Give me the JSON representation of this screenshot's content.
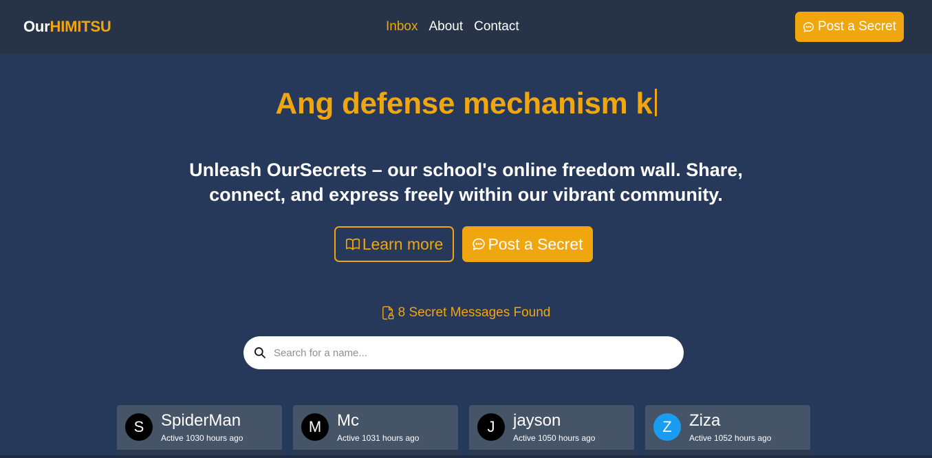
{
  "nav": {
    "logo_part1": "Our",
    "logo_part2": "HIMITSU",
    "links": [
      {
        "label": "Inbox",
        "active": true
      },
      {
        "label": "About",
        "active": false
      },
      {
        "label": "Contact",
        "active": false
      }
    ],
    "post_button": "Post a Secret"
  },
  "hero": {
    "title": "Ang defense mechanism k",
    "subtitle_line1": "Unleash OurSecrets – our school's online freedom wall. Share,",
    "subtitle_line2": "connect, and express freely within our vibrant community.",
    "learn_button": "Learn more",
    "post_button": "Post a Secret"
  },
  "messages": {
    "count_text": "8 Secret Messages Found"
  },
  "search": {
    "placeholder": "Search for a name..."
  },
  "cards": [
    {
      "initial": "S",
      "name": "SpiderMan",
      "status": "Active 1030 hours ago",
      "avatar_color": "#000000"
    },
    {
      "initial": "M",
      "name": "Mc",
      "status": "Active 1031 hours ago",
      "avatar_color": "#000000"
    },
    {
      "initial": "J",
      "name": "jayson",
      "status": "Active 1050 hours ago",
      "avatar_color": "#000000"
    },
    {
      "initial": "Z",
      "name": "Ziza",
      "status": "Active 1052 hours ago",
      "avatar_color": "#1a9cf0"
    }
  ],
  "colors": {
    "accent": "#f0a60f",
    "navbar": "#273447",
    "background": "#27395a",
    "card": "#465468"
  }
}
